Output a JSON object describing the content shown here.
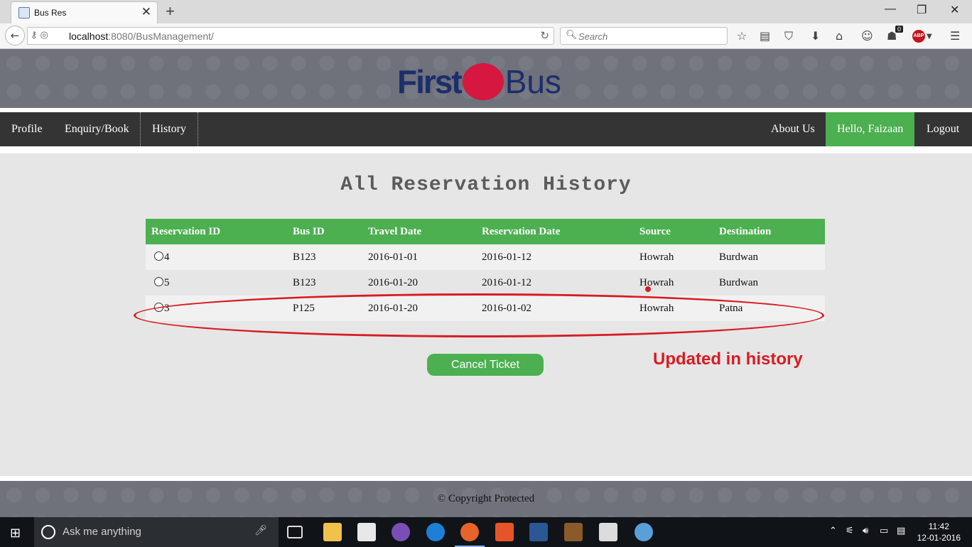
{
  "browser": {
    "tab_title": "Bus Res",
    "url_host": "localhost",
    "url_rest": ":8080/BusManagement/",
    "search_placeholder": "Search",
    "notification_count": "0",
    "adblock_label": "ABP"
  },
  "site": {
    "logo_first": "First",
    "logo_bus": "Bus",
    "brand_color": "#1c2e6b",
    "accent_color": "#4caf50"
  },
  "menu": {
    "profile": "Profile",
    "enquiry": "Enquiry/Book",
    "history": "History",
    "about": "About Us",
    "hello": "Hello, Faizaan",
    "logout": "Logout"
  },
  "main": {
    "heading": "All Reservation History",
    "columns": [
      "Reservation ID",
      "Bus ID",
      "Travel Date",
      "Reservation Date",
      "Source",
      "Destination"
    ],
    "rows": [
      [
        "4",
        "B123",
        "2016-01-01",
        "2016-01-12",
        "Howrah",
        "Burdwan"
      ],
      [
        "5",
        "B123",
        "2016-01-20",
        "2016-01-12",
        "Howrah",
        "Burdwan"
      ],
      [
        "3",
        "P125",
        "2016-01-20",
        "2016-01-02",
        "Howrah",
        "Patna"
      ]
    ],
    "cancel_button": "Cancel Ticket",
    "annotation": "Updated in history",
    "annotation_color": "#d81b22"
  },
  "footer": {
    "copyright": "© Copyright Protected"
  },
  "taskbar": {
    "search_placeholder": "Ask me anything",
    "time": "11:42",
    "date": "12-01-2016"
  }
}
